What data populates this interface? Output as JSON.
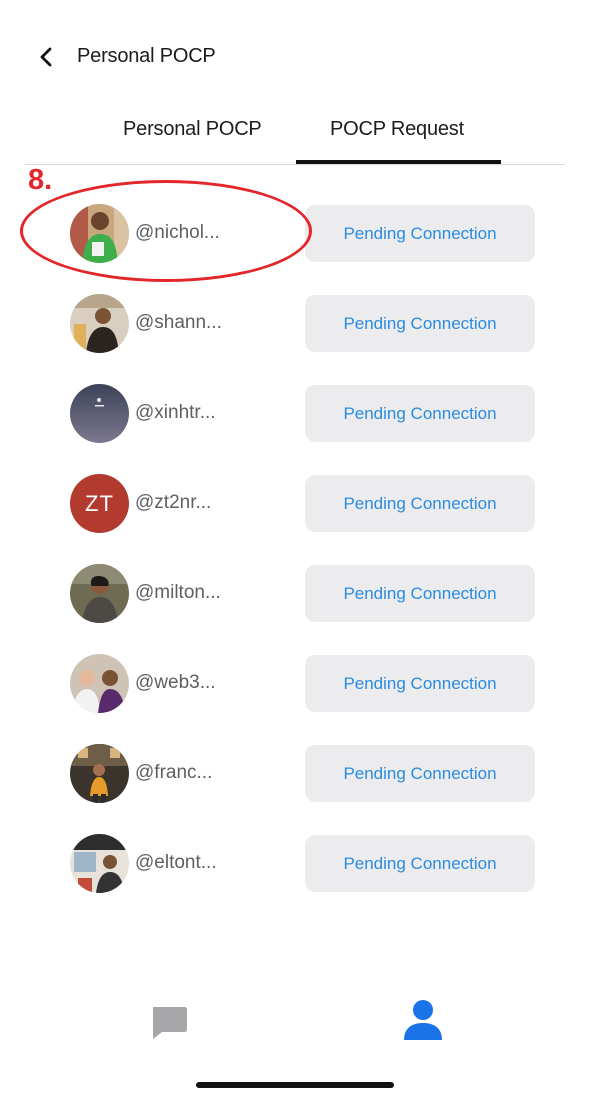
{
  "header": {
    "title": "Personal POCP",
    "back_icon": "chevron-left-icon"
  },
  "tabs": [
    {
      "label": "Personal POCP",
      "active": false
    },
    {
      "label": "POCP Request",
      "active": true
    }
  ],
  "annotation": {
    "label": "8.",
    "color": "#e3262a"
  },
  "requests": [
    {
      "username": "@nichol...",
      "avatar": "photo",
      "action_label": "Pending Connection"
    },
    {
      "username": "@shann...",
      "avatar": "photo",
      "action_label": "Pending Connection"
    },
    {
      "username": "@xinhtr...",
      "avatar": "photo",
      "action_label": "Pending Connection"
    },
    {
      "username": "@zt2nr...",
      "avatar": "initials",
      "initials": "ZT",
      "action_label": "Pending Connection"
    },
    {
      "username": "@milton...",
      "avatar": "photo",
      "action_label": "Pending Connection"
    },
    {
      "username": "@web3...",
      "avatar": "photo",
      "action_label": "Pending Connection"
    },
    {
      "username": "@franc...",
      "avatar": "photo",
      "action_label": "Pending Connection"
    },
    {
      "username": "@eltont...",
      "avatar": "photo",
      "action_label": "Pending Connection"
    }
  ],
  "tabbar": {
    "items": [
      {
        "icon": "chat-icon",
        "active": false
      },
      {
        "icon": "profile-icon",
        "active": true
      }
    ]
  },
  "colors": {
    "accent": "#2a8be0",
    "button_bg": "#ececee",
    "active_icon": "#1a73e8",
    "inactive_icon": "#a6a6a8",
    "initials_bg": "#b23a2e"
  }
}
